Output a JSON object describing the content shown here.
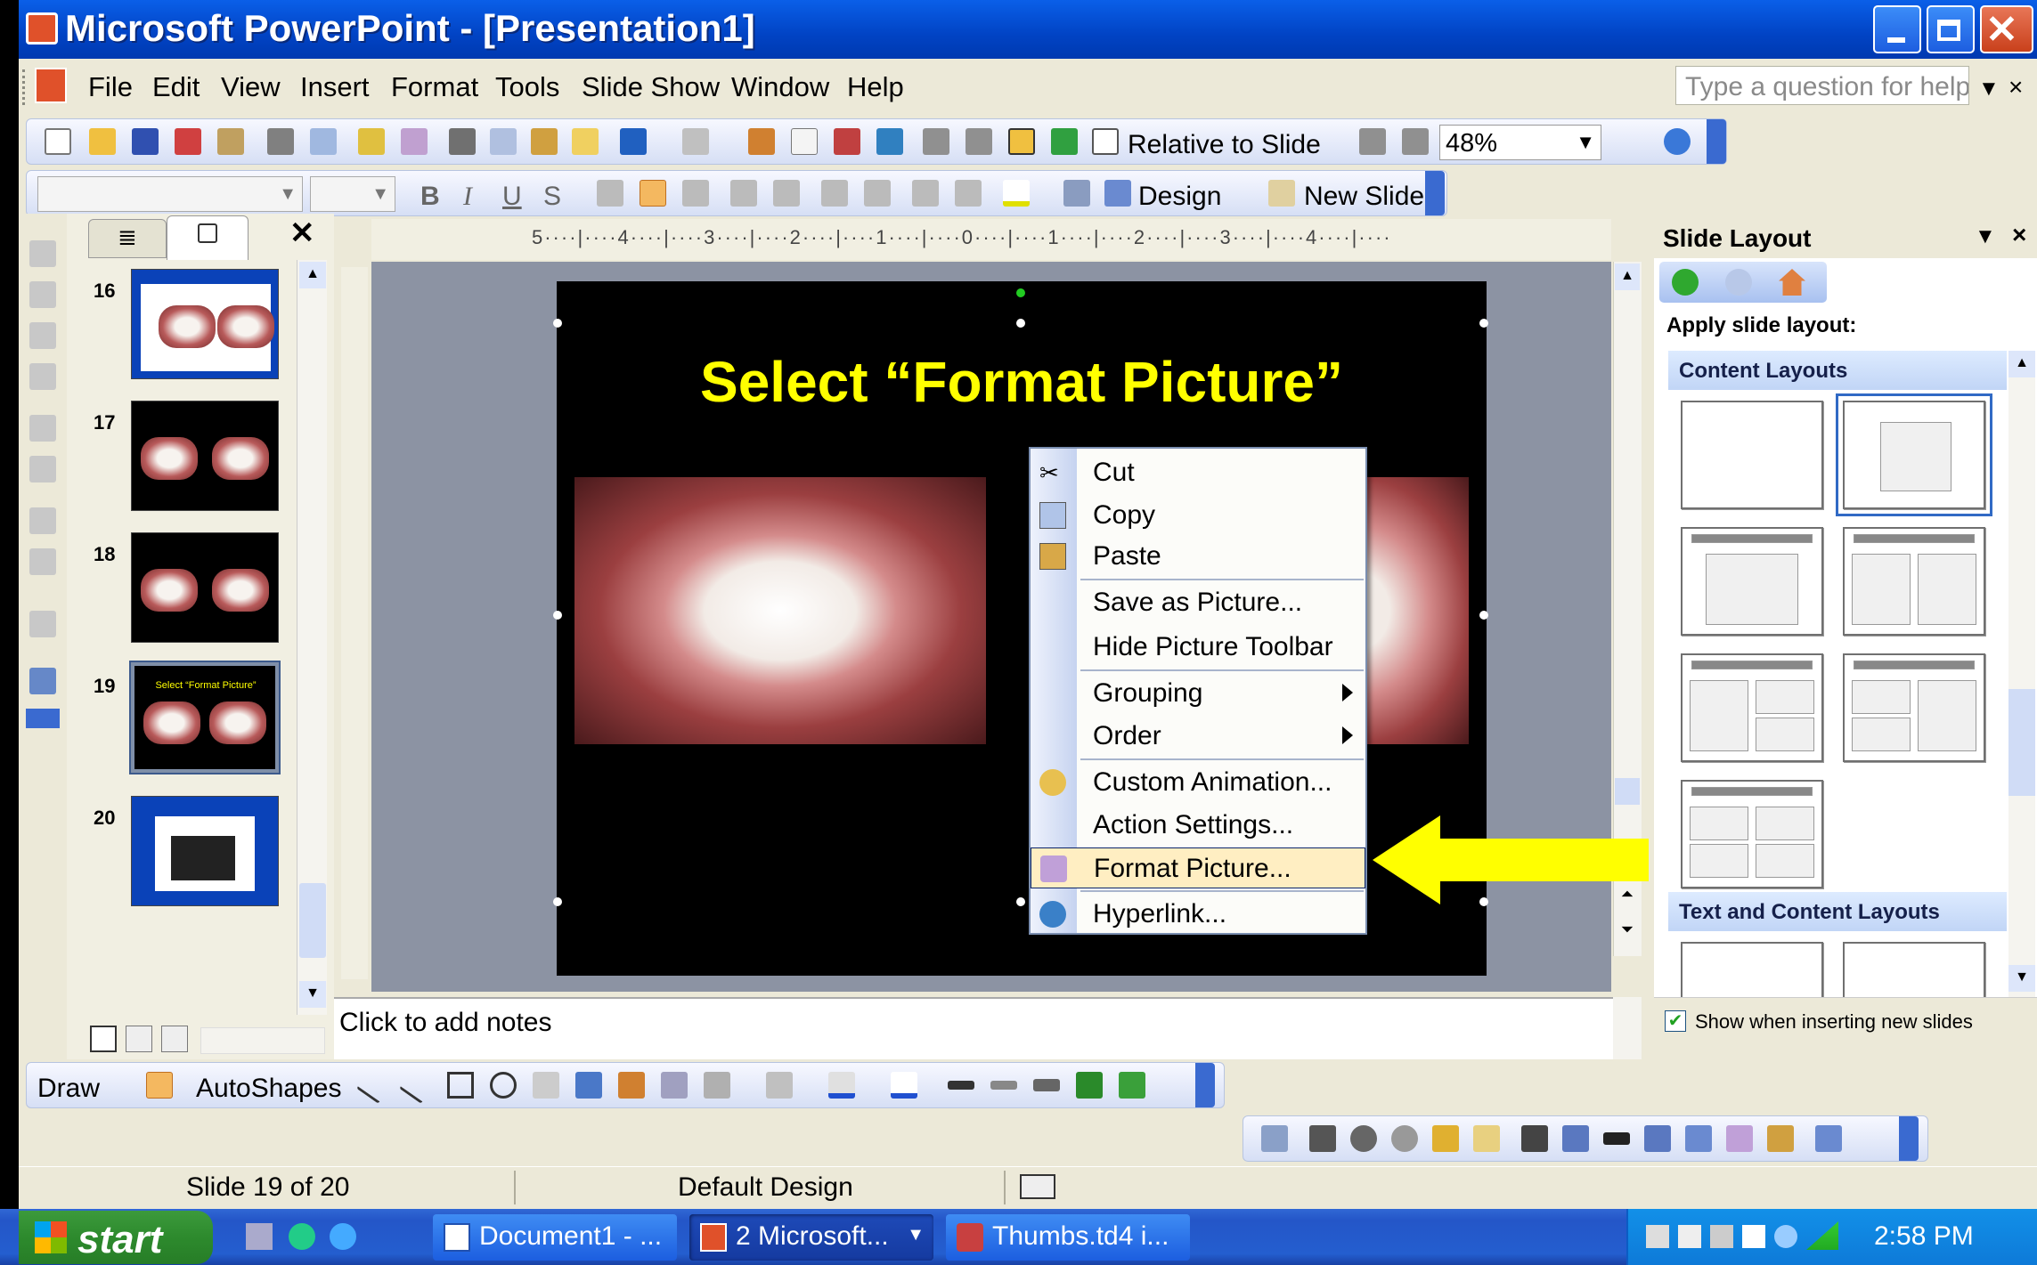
{
  "window": {
    "title": "Microsoft PowerPoint - [Presentation1]"
  },
  "menu": [
    "File",
    "Edit",
    "View",
    "Insert",
    "Format",
    "Tools",
    "Slide Show",
    "Window",
    "Help"
  ],
  "help": {
    "placeholder": "Type a question for help"
  },
  "toolbar": {
    "relative_label": "Relative to Slide",
    "zoom": "48%",
    "design_label": "Design",
    "new_slide_label": "New Slide"
  },
  "format_toolbar": {
    "bold": "B",
    "italic": "I",
    "underline": "U",
    "shadow": "S"
  },
  "thumbnails": [
    {
      "num": "16"
    },
    {
      "num": "17"
    },
    {
      "num": "18"
    },
    {
      "num": "19",
      "caption": "Select “Format Picture”"
    },
    {
      "num": "20"
    }
  ],
  "ruler": {
    "text": "5····|····4····|····3····|····2····|····1····|····0····|····1····|····2····|····3····|····4····|····"
  },
  "slide": {
    "title": "Select “Format Picture”"
  },
  "context_menu": {
    "items": [
      {
        "label": "Cut"
      },
      {
        "label": "Copy"
      },
      {
        "label": "Paste"
      },
      {
        "label": "Save as Picture..."
      },
      {
        "label": "Hide Picture Toolbar"
      },
      {
        "label": "Grouping"
      },
      {
        "label": "Order"
      },
      {
        "label": "Custom Animation..."
      },
      {
        "label": "Action Settings..."
      },
      {
        "label": "Format Picture..."
      },
      {
        "label": "Hyperlink..."
      }
    ],
    "highlighted": "Format Picture..."
  },
  "notes": {
    "placeholder": "Click to add notes"
  },
  "task_pane": {
    "title": "Slide Layout",
    "apply_label": "Apply slide layout:",
    "section1": "Content Layouts",
    "section2": "Text and Content Layouts",
    "show_checkbox": "Show when inserting new slides",
    "show_checked": true
  },
  "drawing_toolbar": {
    "draw_label": "Draw",
    "autoshapes_label": "AutoShapes"
  },
  "status": {
    "slide": "Slide 19 of 20",
    "design": "Default Design"
  },
  "taskbar": {
    "start": "start",
    "tasks": [
      "Document1 - ...",
      "2 Microsoft...",
      "Thumbs.td4 i..."
    ],
    "clock": "2:58 PM"
  },
  "colors": {
    "title_yellow": "#ffff00",
    "xp_blue": "#0a5fe8",
    "arrow_yellow": "#ffff00",
    "highlight": "#ffeec2"
  }
}
